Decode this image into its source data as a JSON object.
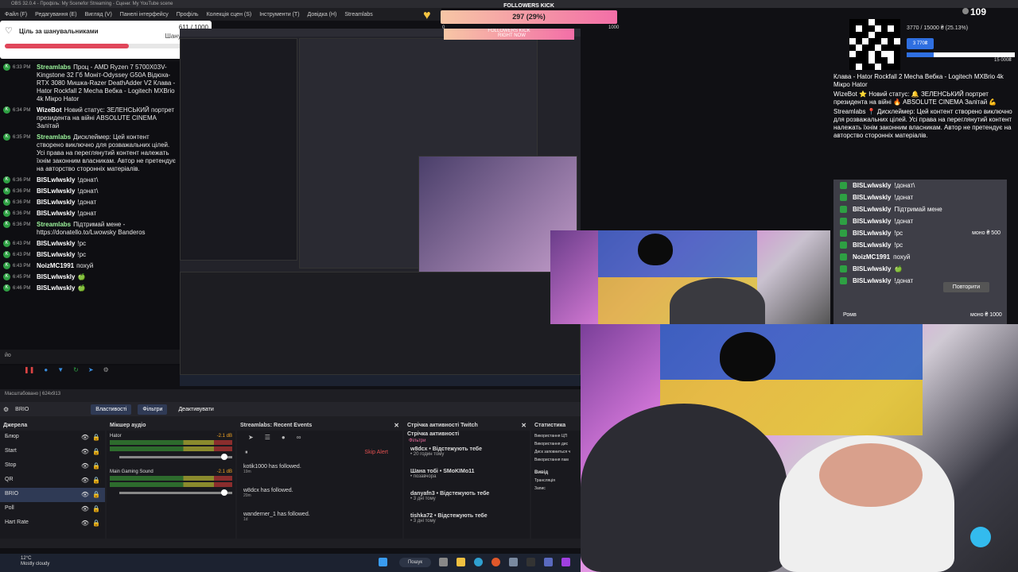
{
  "window": {
    "title": "OBS 32.0.4 - Профіль: My Scenefor Streaming - Сцени: My YouTube scene"
  },
  "menu": [
    "Файл (F)",
    "Редагування (Е)",
    "Вигляд (V)",
    "Панелі інтерфейсу",
    "Профіль",
    "Колекція сцен (S)",
    "Інструменти (T)",
    "Довідка (H)",
    "Streamlabs"
  ],
  "goal": {
    "title": "Ціль за шанувальниками",
    "count": "611 / 1000",
    "sub": "Шанувальники",
    "progress": 0.611
  },
  "chat": [
    {
      "time": "6:33 PM",
      "user": "Streamlabs",
      "text": "Проц - AMD Ryzen 7 5700X03V-Kingstone 32 Гб Моніт-Odyssey G50A Відюха-RTX 3080 Мишка-Razer DeathAdder V2 Клава - Hator Rockfall 2 Mecha Вебка - Logitech MXBrio 4k Мікро Hator"
    },
    {
      "time": "6:34 PM",
      "user": "WizeBot",
      "text": "Новий статус: ЗЕЛЕНСЬКИЙ портрет президента на війні ABSOLUTE CINEMA Залітай"
    },
    {
      "time": "6:35 PM",
      "user": "Streamlabs",
      "text": "Дисклеймер: Цей контент створено виключно для розважальних цілей. Усі права на переглянутий контент належать їхнім законним власникам. Автор не претендує на авторство сторонніх матеріалів."
    },
    {
      "time": "6:36 PM",
      "user": "BISLwlwskly",
      "text": "!донат\\"
    },
    {
      "time": "6:36 PM",
      "user": "BISLwlwskly",
      "text": "!донат\\"
    },
    {
      "time": "6:36 PM",
      "user": "BISLwlwskly",
      "text": "!донат"
    },
    {
      "time": "6:36 PM",
      "user": "BISLwlwskly",
      "text": "!донат"
    },
    {
      "time": "6:36 PM",
      "user": "Streamlabs",
      "text": "Підтримай мене - https://donatello.to/Lwowsky Banderos"
    },
    {
      "time": "6:43 PM",
      "user": "BISLwlwskly",
      "text": "!рс"
    },
    {
      "time": "6:43 PM",
      "user": "BISLwlwskly",
      "text": "!рс"
    },
    {
      "time": "6:43 PM",
      "user": "NoizMC1991",
      "text": "похуй"
    },
    {
      "time": "6:45 PM",
      "user": "BISLwlwskly",
      "text": "🍏"
    },
    {
      "time": "6:46 PM",
      "user": "BISLwlwskly",
      "text": "🍏"
    }
  ],
  "chat_input": "йо",
  "followers": {
    "label": "FOLLOWERS KICK",
    "value": "297 (29%)",
    "progress": 0.297,
    "min": "0",
    "max": "1000"
  },
  "nested_labels": {
    "followers_mini": "FOLLOWERS KICK",
    "right_now": "RIGHT NOW"
  },
  "donations": {
    "info": "3770 / 15000 ₴ (25.13%)",
    "button": "3 770₴",
    "max": "15 000₴",
    "progress": 0.2513
  },
  "viewers": "109",
  "right_chat": [
    "Клава - Hator Rockfall 2 Mecha Вебка - Logitech MXBrio 4k Мікро Hator",
    "WizeBot ⭐ Новий статус: 🔔 ЗЕЛЕНСЬКИЙ портрет президента на війні 🔥 ABSOLUTE CINEMA Залітай 💪",
    "Streamlabs 📍 Дисклеймер: Цей контент створено виключно для розважальних цілей. Усі права на переглянутий контент належать їхнім законним власникам. Автор не претендує на авторство сторонніх матеріалів."
  ],
  "right_panel": [
    {
      "user": "BISLwlwskly",
      "text": "!донат\\",
      "amount": ""
    },
    {
      "user": "BISLwlwskly",
      "text": "!донат",
      "amount": ""
    },
    {
      "user": "BISLwlwskly",
      "text": "Підтримай мене",
      "amount": ""
    },
    {
      "user": "BISLwlwskly",
      "text": "!донат",
      "amount": ""
    },
    {
      "user": "BISLwlwskly",
      "text": "!рс",
      "amount": "моно ₴ 500"
    },
    {
      "user": "BISLwlwskly",
      "text": "!рс",
      "amount": ""
    },
    {
      "user": "NoizMC1991",
      "text": "похуй",
      "amount": ""
    },
    {
      "user": "BISLwlwskly",
      "text": "🍏",
      "amount": ""
    },
    {
      "user": "BISLwlwskly",
      "text": "!донат",
      "amount": ""
    }
  ],
  "right_panel_extra": {
    "repeat": "Повторити",
    "romv": "Ромв",
    "romv_amount": "моно ₴ 1000"
  },
  "obs": {
    "status": "Масштабовано | 624x913",
    "selected_source": "BRIO",
    "tabs": [
      "Властивості",
      "Фільтри",
      "Деактивувати"
    ],
    "sources_title": "Джерела",
    "sources": [
      "Блюр",
      "Start",
      "Stop",
      "QR",
      "BRIO",
      "Poll",
      "Hart Rate"
    ],
    "mixer_title": "Мікшер аудіо",
    "mixer": [
      {
        "name": "Hator",
        "db": "-2.1 dB"
      },
      {
        "name": "Main Gaming Sound",
        "db": "-2.1 dB"
      }
    ],
    "events_title": "Streamlabs: Recent Events",
    "skip_alert": "Skip Alert",
    "events": [
      {
        "name": "kotik1000 has followed.",
        "time": "19m"
      },
      {
        "name": "w8dcx has followed.",
        "time": "20m"
      },
      {
        "name": "wanderner_1 has followed.",
        "time": "1d"
      }
    ],
    "activity_title": "Стрічка активності Twitch",
    "activity_sub": "Стрічка активності",
    "filters": "Фільтри",
    "activity": [
      {
        "name": "w8dcx • Відстежують тебе",
        "sub": "• 20 годин тому"
      },
      {
        "name": "Шана тобі • SMoKIMo11",
        "sub": "• позавчора"
      },
      {
        "name": "danyafn3 • Відстежують тебе",
        "sub": "• 3 дні тому"
      },
      {
        "name": "tishka72 • Відстежують тебе",
        "sub": "• 3 дні тому"
      }
    ],
    "stats_title": "Статистика",
    "stats": [
      "Використання ЦП",
      "Використання дис",
      "Диск заповниться ч",
      "Використання пам"
    ],
    "output_title": "Вивід",
    "output": [
      "Трансляція",
      "Запис"
    ]
  },
  "taskbar": {
    "weather_temp": "12°C",
    "weather_desc": "Mostly cloudy",
    "search": "Пошук"
  },
  "colors": {
    "accent": "#2f6fe0",
    "kick_green": "#2ea043",
    "follow_gradient_start": "#f7c6a5",
    "follow_gradient_end": "#f36ea7"
  }
}
